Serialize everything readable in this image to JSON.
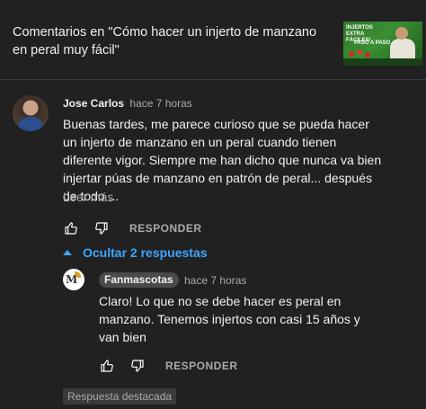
{
  "header": {
    "title": "Comentarios en \"Cómo hacer un injerto de manzano en peral muy fácil\"",
    "thumbnail": {
      "line1": "INJERTOS EXTRA FÁCILES!",
      "line2": "PASO A PASO"
    }
  },
  "comment": {
    "author": "Jose Carlos",
    "time": "hace 7 horas",
    "text": "Buenas tardes, me parece curioso que se pueda hacer un injerto de manzano en un peral cuando tienen diferente vigor. Siempre me han dicho que nunca va bien injertar púas de manzano en patrón de peral... después de todo ...",
    "read_more": "Leer más",
    "reply_label": "RESPONDER",
    "hide_replies": "Ocultar 2 respuestas"
  },
  "reply": {
    "author": "Fanmascotas",
    "time": "hace 7 horas",
    "text": "Claro! Lo que no se debe hacer es peral en manzano. Tenemos injertos con casi 15 años y van bien",
    "reply_label": "RESPONDER",
    "featured": "Respuesta destacada"
  },
  "colors": {
    "background": "#212121",
    "link_blue": "#3ea6ff",
    "muted": "#aaaaaa"
  },
  "icons": [
    "like-icon",
    "dislike-icon",
    "chevron-up-icon"
  ]
}
